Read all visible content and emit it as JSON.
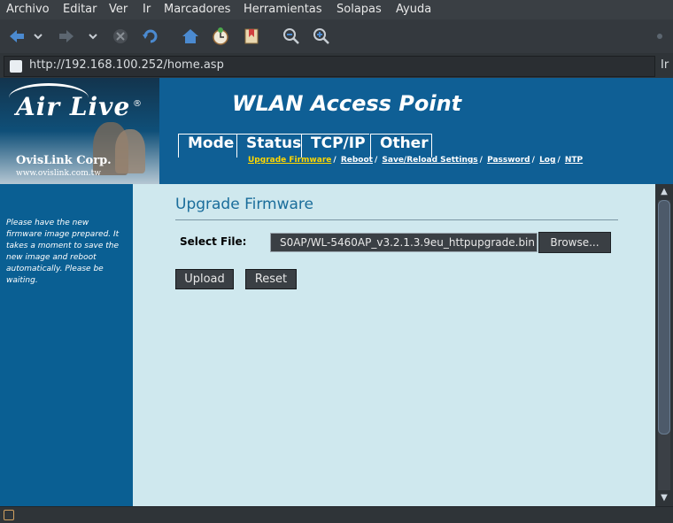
{
  "menu": [
    "Archivo",
    "Editar",
    "Ver",
    "Ir",
    "Marcadores",
    "Herramientas",
    "Solapas",
    "Ayuda"
  ],
  "toolbar": {
    "back_icon": "back-arrow-icon",
    "forward_icon": "forward-arrow-icon",
    "stop_icon": "stop-icon",
    "reload_icon": "reload-icon",
    "home_icon": "home-icon",
    "history_icon": "history-icon",
    "bookmark_icon": "bookmark-icon",
    "zoom_out_icon": "zoom-out-icon",
    "zoom_in_icon": "zoom-in-icon"
  },
  "url": {
    "value": "http://192.168.100.252/home.asp",
    "go_label": "Ir"
  },
  "header": {
    "brand": "Air Live",
    "registered": "®",
    "company": "OvisLink Corp.",
    "website": "www.ovislink.com.tw",
    "title": "WLAN Access Point",
    "tabs": [
      "Mode",
      "Status",
      "TCP/IP",
      "Other"
    ],
    "sublinks": [
      "Upgrade Firmware",
      "Reboot",
      "Save/Reload Settings",
      "Password",
      "Log",
      "NTP"
    ]
  },
  "sidebar": {
    "text": "Please have the new firmware image prepared. It takes a moment to save the new image and reboot automatically. Please be waiting."
  },
  "main": {
    "title": "Upgrade Firmware",
    "select_label": "Select File:",
    "file_value": "S0AP/WL-5460AP_v3.2.1.3.9eu_httpupgrade.bin",
    "browse_label": "Browse...",
    "upload_label": "Upload",
    "reset_label": "Reset"
  },
  "colors": {
    "accent": "#0f5f95",
    "panel_bg": "#cfe8ee",
    "title_color": "#1a6d9b",
    "active_link": "#ffd700"
  }
}
